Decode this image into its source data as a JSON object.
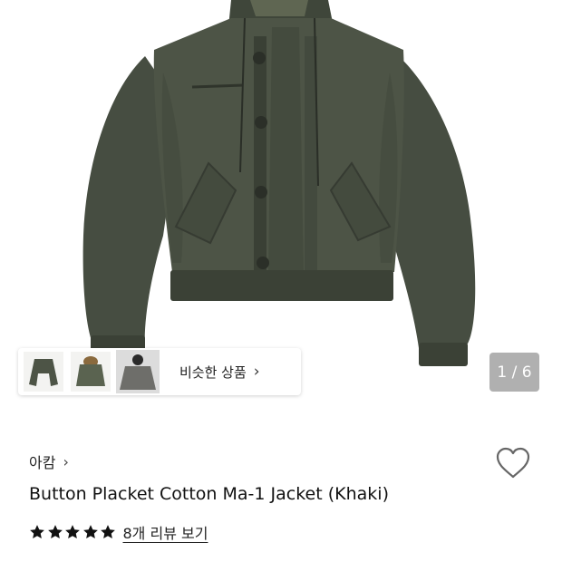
{
  "product": {
    "brand": "아캄",
    "title": "Button Placket Cotton Ma-1 Jacket (Khaki)",
    "rating_stars": 5,
    "review_link": "8개 리뷰 보기"
  },
  "gallery": {
    "counter": "1 / 6",
    "similar_label": "비슷한 상품",
    "thumbnails": [
      "jacket-front-thumbnail",
      "jacket-hooded-thumbnail",
      "model-wearing-thumbnail"
    ]
  },
  "colors": {
    "jacket": "#4d5446",
    "star": "#111111"
  },
  "icons": {
    "chevron": "›",
    "heart": "heart-outline-icon",
    "star": "filled-star-icon"
  }
}
